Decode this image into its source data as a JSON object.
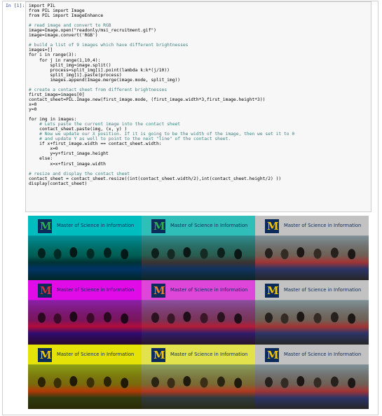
{
  "prompt": "In [1]:",
  "code_lines": [
    "import PIL",
    "from PIL import Image",
    "from PIL import ImageEnhance",
    "",
    "# read image and convert to RGB",
    "image=Image.open(\"readonly/msi_recruitment.gif\")",
    "image=image.convert('RGB')",
    "",
    "# build a list of 9 images which have different brightnesses",
    "images=[]",
    "for i in range(3):",
    "    for j in range(1,10,4):",
    "        split_img=image.split()",
    "        process=split_img[i].point(lambda k:k*(j/10))",
    "        split_img[i].paste(process)",
    "        images.append(Image.merge(image.mode, split_img))",
    "",
    "# create a contact sheet from different brightnesses",
    "first_image=images[0]",
    "contact_sheet=PIL.Image.new(first_image.mode, (first_image.width*3,first_image.height*3))",
    "x=0",
    "y=0",
    "",
    "for img in images:",
    "    # Lets paste the current image into the contact sheet",
    "    contact_sheet.paste(img, (x, y) )",
    "    # Now we update our X position. If it is going to be the width of the image, then we set it to 0",
    "    # and update Y as well to point to the next \"line\" of the contact sheet.",
    "    if x+first_image.width == contact_sheet.width:",
    "        x=0",
    "        y=y+first_image.height",
    "    else:",
    "        x=x+first_image.width",
    "",
    "# resize and display the contact sheet",
    "contact_sheet = contact_sheet.resize((int(contact_sheet.width/2),int(contact_sheet.height/2) ))",
    "display(contact_sheet)"
  ],
  "tile_text": "Master of Science in Information",
  "logo_letter": "M",
  "tiles": [
    {
      "tint": "#00e5e5",
      "header": "#29d3d6",
      "letter_color": "#2bb24a"
    },
    {
      "tint": "#55e0d8",
      "header": "#8bd9d9",
      "letter_color": "#2bb24a"
    },
    {
      "tint": "#e8e8e8",
      "header": "#d6d6d6",
      "letter_color": "#f5c400"
    },
    {
      "tint": "#ff33ff",
      "header": "#e037e6",
      "letter_color": "#e02d2d"
    },
    {
      "tint": "#ff7df0",
      "header": "#dd8fe6",
      "letter_color": "#f07a2e"
    },
    {
      "tint": "#e8e8e8",
      "header": "#d6d6d6",
      "letter_color": "#f5c400"
    },
    {
      "tint": "#ffff20",
      "header": "#e4e22a",
      "letter_color": "#f5c400"
    },
    {
      "tint": "#ffff8c",
      "header": "#e2e28a",
      "letter_color": "#f5c400"
    },
    {
      "tint": "#e8e8e8",
      "header": "#d6d6d6",
      "letter_color": "#f5c400"
    }
  ]
}
